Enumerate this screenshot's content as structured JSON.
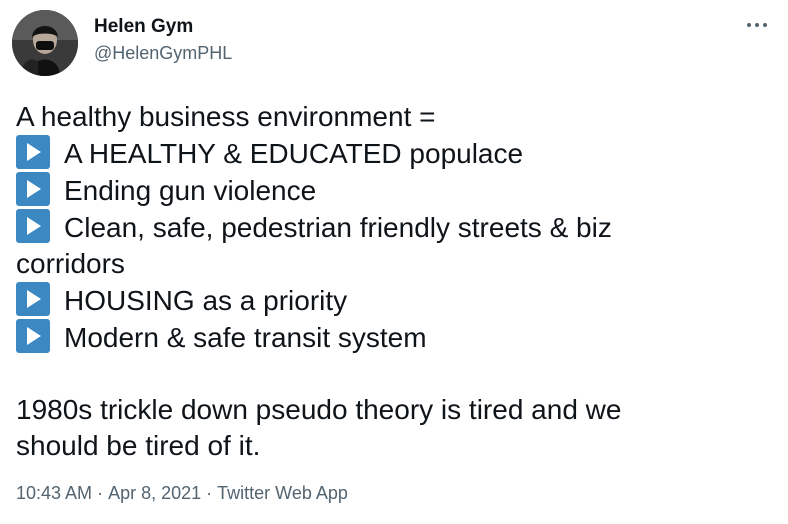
{
  "author": {
    "display_name": "Helen Gym",
    "handle": "@HelenGymPHL",
    "avatar_icon": "profile-photo"
  },
  "tweet": {
    "intro": "A healthy business environment =",
    "bullet_icon": "play-button-emoji",
    "bullets": [
      "A HEALTHY & EDUCATED populace",
      "Ending gun violence",
      "Clean, safe, pedestrian friendly streets & biz",
      "HOUSING as a priority",
      "Modern & safe transit system"
    ],
    "bullet_wrap": "corridors",
    "closing_line_1": "1980s trickle down pseudo theory is tired and we",
    "closing_line_2": "should be tired of it."
  },
  "meta": {
    "time": "10:43 AM",
    "separator": "·",
    "date": "Apr 8, 2021",
    "source": "Twitter Web App"
  },
  "colors": {
    "text": "#0f1419",
    "secondary": "#536471",
    "emoji_blue": "#3b88c3"
  }
}
